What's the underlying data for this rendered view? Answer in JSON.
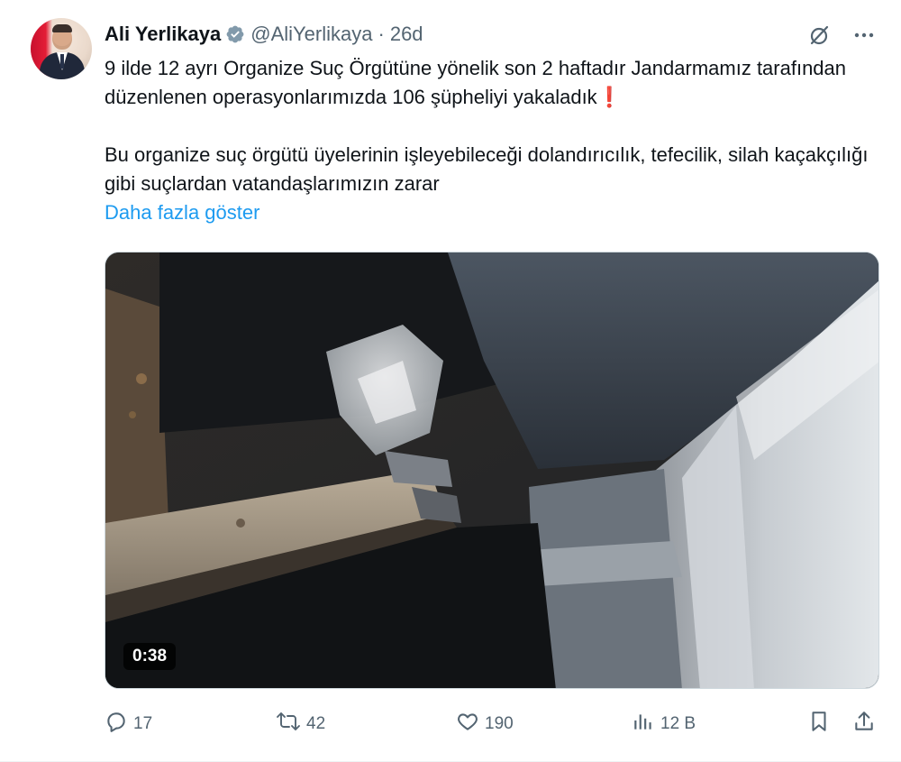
{
  "author": {
    "name": "Ali Yerlikaya",
    "handle": "@AliYerlikaya",
    "separator": "·",
    "time": "26d"
  },
  "tweet": {
    "line1": "9 ilde 12 ayrı Organize Suç Örgütüne yönelik son 2 haftadır Jandarmamız tarafından düzenlenen operasyonlarımızda 106 şüpheliyi yakaladık",
    "exclaim": "❗",
    "line2": "Bu organize suç örgütü üyelerinin işleyebileceği dolandırıcılık, tefecilik, silah kaçakçılığı gibi suçlardan vatandaşlarımızın zarar",
    "show_more": "Daha fazla göster"
  },
  "media": {
    "duration": "0:38"
  },
  "stats": {
    "replies": "17",
    "retweets": "42",
    "likes": "190",
    "views": "12 B"
  },
  "colors": {
    "link": "#1d9bf0",
    "muted": "#536471",
    "verified": "#829aab",
    "exclaim": "#dd2e44"
  },
  "icons": {
    "verified": "verified-badge-icon",
    "grok": "grok-icon",
    "more": "more-icon",
    "reply": "reply-icon",
    "retweet": "retweet-icon",
    "like": "heart-icon",
    "views": "views-icon",
    "bookmark": "bookmark-icon",
    "share": "share-icon"
  }
}
